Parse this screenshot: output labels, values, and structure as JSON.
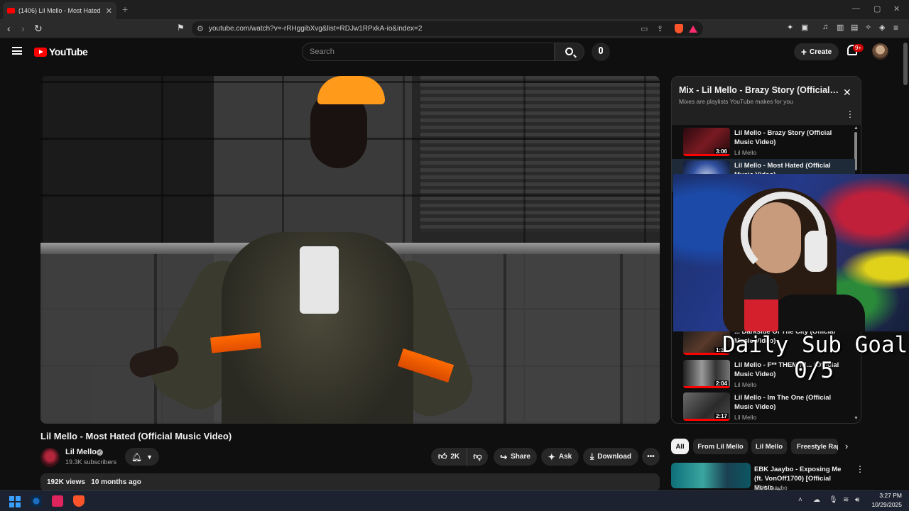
{
  "browser": {
    "tab_title": "(1406) Lil Mello - Most Hated",
    "url": "youtube.com/watch?v=-rRHggibXvg&list=RDJw1RPxkA-io&index=2",
    "new_tab": "+",
    "close": "✕"
  },
  "yt": {
    "logo": "YouTube",
    "search_placeholder": "Search",
    "create_label": "Create",
    "notif_count": "9+"
  },
  "video": {
    "title": "Lil Mello - Most Hated (Official Music Video)",
    "channel": "Lil Mello",
    "subscribers": "19.3K subscribers",
    "likes": "2K",
    "share": "Share",
    "ask": "Ask",
    "download": "Download",
    "views": "192K views",
    "age": "10 months ago"
  },
  "playlist": {
    "title": "Mix - Lil Mello - Brazy Story (Official Music Video)",
    "subtitle": "Mixes are playlists YouTube makes for you",
    "items": [
      {
        "title": "Lil Mello - Brazy Story (Official Music Video)",
        "channel": "Lil Mello",
        "duration": "3:06"
      },
      {
        "title": "Lil Mello - Most Hated (Official Music Video)",
        "channel": "",
        "duration": ""
      },
      {
        "title": "... Darkside Of The City (Official Music Video)",
        "channel": "",
        "duration": "1:39"
      },
      {
        "title": "Lil Mello - F** THEM NI... (Official Music Video)",
        "channel": "Lil Mello",
        "duration": "2:04"
      },
      {
        "title": "Lil Mello - Im The One (Official Music Video)",
        "channel": "Lil Mello",
        "duration": "2:17"
      }
    ]
  },
  "overlay": {
    "goal_label": "Daily Sub Goal",
    "goal_count": "0/5"
  },
  "chips": [
    "All",
    "From Lil Mello",
    "Lil Mello",
    "Freestyle Rap"
  ],
  "recommendation": {
    "title": "EBK Jaaybo - Exposing Me (ft. VonOff1700) [Official Music ...",
    "channel": "EBK Jaaybo"
  },
  "taskbar": {
    "time": "3:27 PM",
    "date": "10/29/2025"
  },
  "colors": {
    "accent": "#ff0000",
    "background": "#0f0f0f",
    "chip_bg": "#272727"
  }
}
